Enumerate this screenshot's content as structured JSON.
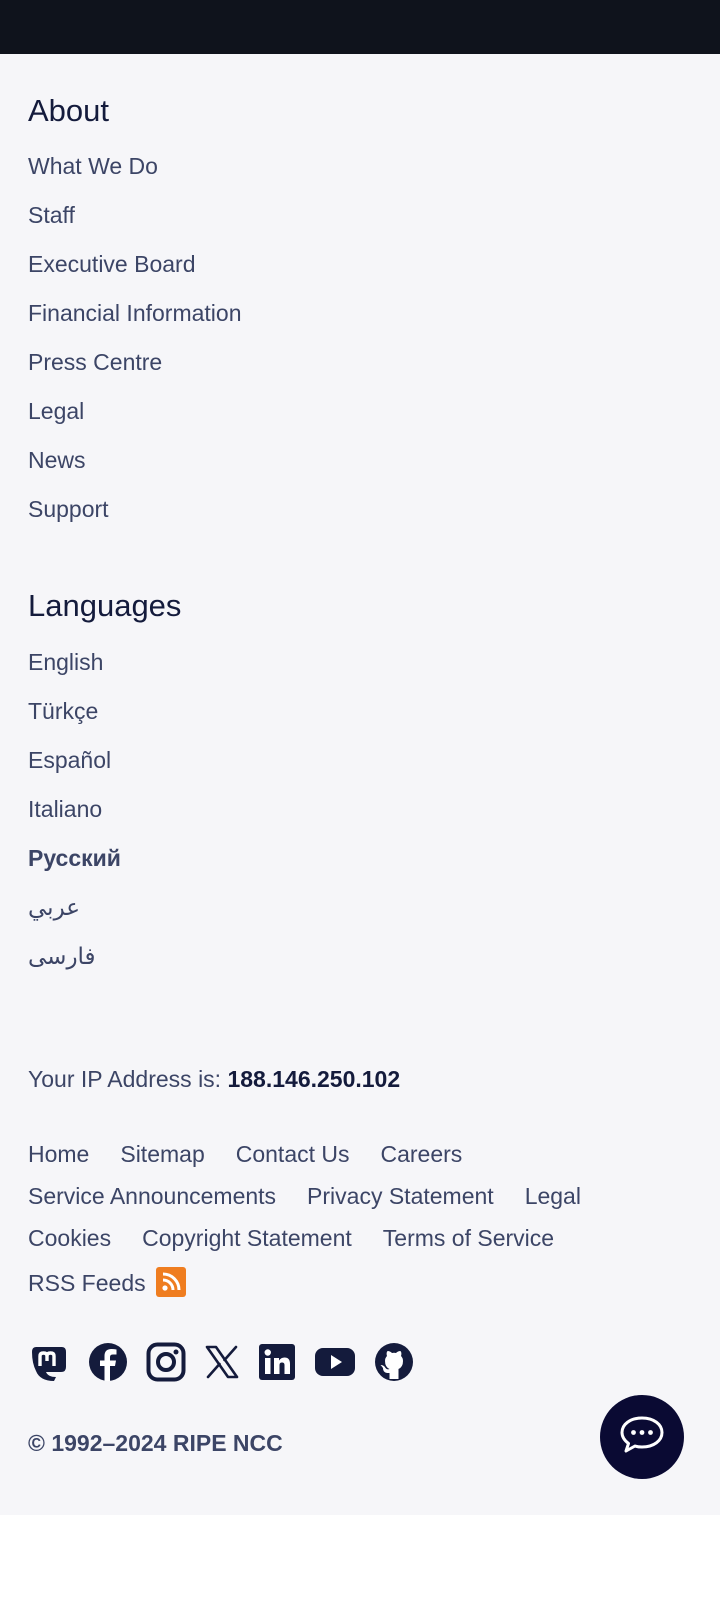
{
  "about": {
    "title": "About",
    "links": [
      "What We Do",
      "Staff",
      "Executive Board",
      "Financial Information",
      "Press Centre",
      "Legal",
      "News",
      "Support"
    ]
  },
  "languages": {
    "title": "Languages",
    "links": [
      "English",
      "Türkçe",
      "Español",
      "Italiano",
      "Русский",
      "عربي",
      "فارسی"
    ]
  },
  "ip": {
    "label": "Your IP Address is:",
    "value": "188.146.250.102"
  },
  "bottom_links": [
    [
      "Home",
      "Sitemap",
      "Contact Us",
      "Careers"
    ],
    [
      "Service Announcements",
      "Privacy Statement",
      "Legal"
    ],
    [
      "Cookies",
      "Copyright Statement",
      "Terms of Service"
    ],
    [
      "RSS Feeds"
    ]
  ],
  "social_icons": [
    "mastodon-icon",
    "facebook-icon",
    "instagram-icon",
    "x-icon",
    "linkedin-icon",
    "youtube-icon",
    "github-icon"
  ],
  "copyright": "© 1992–2024 RIPE NCC",
  "colors": {
    "top_bar": "#0f131c",
    "footer_bg": "#f6f6f9",
    "heading": "#141b3c",
    "link": "#3c4566",
    "rss": "#ef7d20",
    "chat_button": "#0a0a33"
  }
}
